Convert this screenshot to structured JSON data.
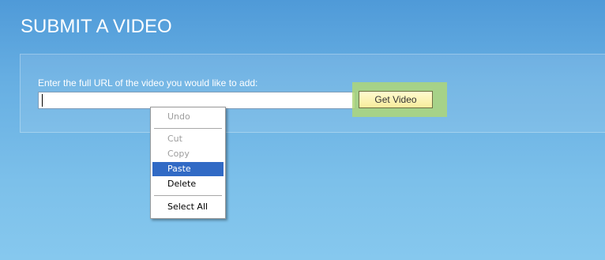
{
  "page": {
    "title": "SUBMIT A VIDEO"
  },
  "form": {
    "prompt": "Enter the full URL of the video you would like to add:",
    "url_value": "",
    "url_placeholder": "",
    "button_label": "Get Video"
  },
  "context_menu": {
    "items": [
      {
        "label": "Undo",
        "enabled": false
      },
      {
        "label": "Cut",
        "enabled": false
      },
      {
        "label": "Copy",
        "enabled": false
      },
      {
        "label": "Paste",
        "enabled": true,
        "selected": true
      },
      {
        "label": "Delete",
        "enabled": true
      },
      {
        "label": "Select All",
        "enabled": true
      }
    ]
  },
  "colors": {
    "panel_top": "#4f9ad8",
    "panel_bottom": "#86c8ee",
    "button_highlight": "#aed678",
    "menu_selection": "#316ac5"
  }
}
